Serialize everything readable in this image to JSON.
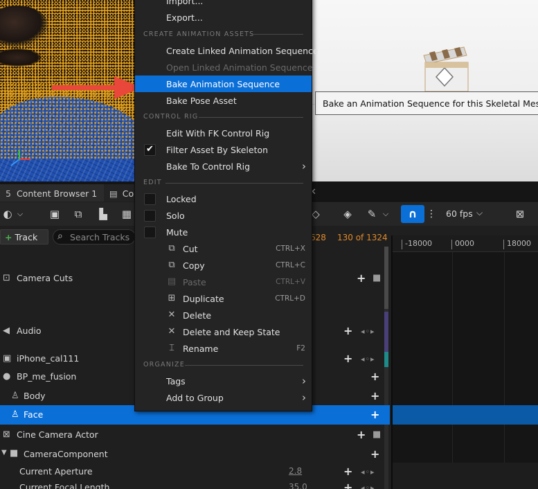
{
  "context_menu": {
    "items_top": [
      {
        "label": "Import...",
        "icon": "none"
      },
      {
        "label": "Export...",
        "icon": "none"
      }
    ],
    "section_create": "CREATE ANIMATION ASSETS",
    "create_items": [
      {
        "label": "Create Linked Animation Sequence",
        "state": "enabled"
      },
      {
        "label": "Open Linked Animation Sequence",
        "state": "disabled"
      },
      {
        "label": "Bake Animation Sequence",
        "state": "highlighted"
      },
      {
        "label": "Bake Pose Asset",
        "state": "enabled"
      }
    ],
    "section_control_rig": "CONTROL RIG",
    "control_rig_items": [
      {
        "label": "Edit With FK Control Rig",
        "checkbox": false
      },
      {
        "label": "Filter Asset By Skeleton",
        "checkbox": true,
        "checked": true
      },
      {
        "label": "Bake To Control Rig",
        "submenu": true
      }
    ],
    "section_edit": "EDIT",
    "edit_toggles": [
      {
        "label": "Locked",
        "checked": false
      },
      {
        "label": "Solo",
        "checked": false
      },
      {
        "label": "Mute",
        "checked": false
      }
    ],
    "edit_actions": [
      {
        "label": "Cut",
        "shortcut": "CTRL+X",
        "icon": "cut-icon",
        "disabled": false
      },
      {
        "label": "Copy",
        "shortcut": "CTRL+C",
        "icon": "copy-icon",
        "disabled": false
      },
      {
        "label": "Paste",
        "shortcut": "CTRL+V",
        "icon": "paste-icon",
        "disabled": true
      },
      {
        "label": "Duplicate",
        "shortcut": "CTRL+D",
        "icon": "duplicate-icon",
        "disabled": false
      },
      {
        "label": "Delete",
        "shortcut": "",
        "icon": "delete-x-icon",
        "disabled": false
      },
      {
        "label": "Delete and Keep State",
        "shortcut": "",
        "icon": "delete-x-icon",
        "disabled": false
      },
      {
        "label": "Rename",
        "shortcut": "F2",
        "icon": "rename-icon",
        "disabled": false
      }
    ],
    "section_organize": "ORGANIZE",
    "organize_items": [
      {
        "label": "Tags",
        "submenu": true
      },
      {
        "label": "Add to Group",
        "submenu": true
      }
    ]
  },
  "tooltip": "Bake an Animation Sequence for this Skeletal Mesh. Note i",
  "tabs": [
    {
      "label": "Content Browser 1",
      "icon": "folder-icon"
    },
    {
      "label": "Con",
      "icon": "clapper-icon"
    }
  ],
  "toolbar": {
    "fps": "60 fps",
    "snap_icon": "magnet-icon"
  },
  "filterbar": {
    "track_button": "Track",
    "search_placeholder": "Search Tracks",
    "frame_start_partial": "628",
    "frame_counter": "130 of 1324"
  },
  "timeline": {
    "ticks": [
      "-18000",
      "0000",
      "18000"
    ]
  },
  "tracks": [
    {
      "label": "Camera Cuts",
      "icon": "camera-cuts-icon"
    },
    {
      "label": "Audio",
      "icon": "audio-icon"
    },
    {
      "label": "iPhone_cal111",
      "icon": "level-sequence-icon"
    },
    {
      "label": "BP_me_fusion",
      "icon": "actor-icon"
    },
    {
      "label": "Body",
      "icon": "skeletal-mesh-icon"
    },
    {
      "label": "Face",
      "icon": "skeletal-mesh-icon",
      "selected": true
    },
    {
      "label": "Cine Camera Actor",
      "icon": "cine-camera-icon"
    },
    {
      "label": "CameraComponent",
      "icon": "camera-component-icon"
    },
    {
      "label": "Current Aperture",
      "value": "2.8"
    },
    {
      "label": "Current Focal Length",
      "value": "35.0"
    }
  ],
  "colors": {
    "accent": "#0b6fd8",
    "frame_counter": "#e38b2b",
    "viewport_mesh": "#e8a41c"
  }
}
